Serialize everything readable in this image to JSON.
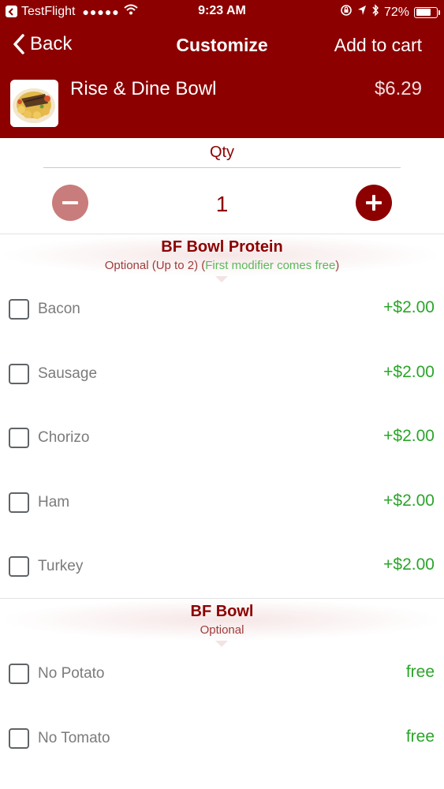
{
  "status_bar": {
    "carrier": "TestFlight",
    "signal": "●●●●●",
    "time": "9:23 AM",
    "battery": "72%",
    "battery_level": 0.72,
    "icons": [
      "back-arrow-box-icon",
      "wifi-icon",
      "lock-rotation-icon",
      "location-icon",
      "bluetooth-icon",
      "battery-icon"
    ]
  },
  "nav": {
    "back_label": "Back",
    "title": "Customize",
    "add_label": "Add to cart"
  },
  "item": {
    "name": "Rise & Dine Bowl",
    "price": "$6.29"
  },
  "qty": {
    "label": "Qty",
    "value": "1"
  },
  "sections": [
    {
      "title": "BF Bowl Protein",
      "sub_prefix": "Optional (Up to 2) (",
      "sub_highlight": "First modifier comes free",
      "sub_suffix": ")",
      "options": [
        {
          "label": "Bacon",
          "price": "+$2.00"
        },
        {
          "label": "Sausage",
          "price": "+$2.00"
        },
        {
          "label": "Chorizo",
          "price": "+$2.00"
        },
        {
          "label": "Ham",
          "price": "+$2.00"
        },
        {
          "label": "Turkey",
          "price": "+$2.00"
        }
      ]
    },
    {
      "title": "BF Bowl",
      "sub": "Optional",
      "options": [
        {
          "label": "No Potato",
          "price": "free"
        },
        {
          "label": "No Tomato",
          "price": "free"
        }
      ]
    }
  ],
  "colors": {
    "brand": "#8c0000",
    "price_green": "#2aa52a",
    "minus_disabled": "#c97c7c"
  }
}
